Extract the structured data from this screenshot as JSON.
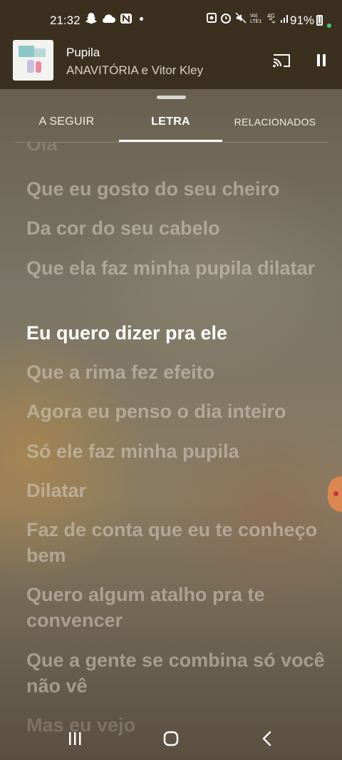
{
  "status_bar": {
    "time": "21:32",
    "battery": "91%",
    "network": "4G"
  },
  "now_playing": {
    "title": "Pupila",
    "artist": "ANAVITÓRIA e Vitor Kley"
  },
  "tabs": [
    {
      "label": "A SEGUIR",
      "selected": false
    },
    {
      "label": "LETRA",
      "selected": true
    },
    {
      "label": "RELACIONADOS",
      "selected": false
    }
  ],
  "lyrics": {
    "current_index": 4,
    "lines": [
      "Ola",
      "Que eu gosto do seu cheiro",
      "Da cor do seu cabelo",
      "Que ela faz minha pupila dilatar",
      "Eu quero dizer pra ele",
      "Que a rima fez efeito",
      "Agora eu penso o dia inteiro",
      "Só ele faz minha pupila",
      "Dilatar",
      "Faz de conta que eu te conheço bem",
      "Quero algum atalho pra te convencer",
      "Que a gente se combina só você não vê",
      "Mas eu vejo"
    ]
  },
  "icons": {
    "cast": "cast-icon",
    "pause": "pause-icon",
    "recents": "recents-icon",
    "home": "home-icon",
    "back": "back-icon"
  },
  "colors": {
    "highlight": "#ffffff",
    "inactive_lyric": "#d7d0c4"
  }
}
